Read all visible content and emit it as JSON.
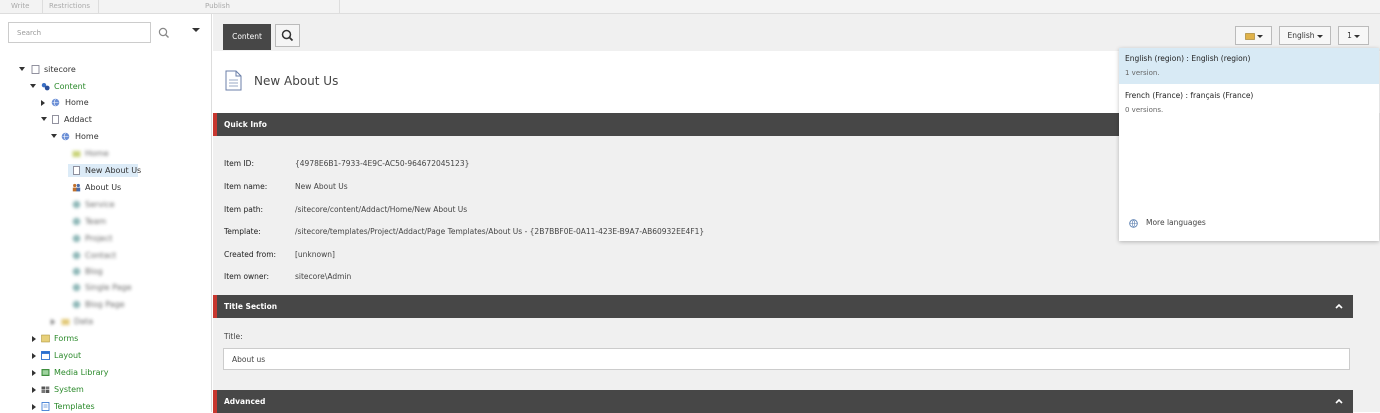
{
  "topbar": {
    "items": [
      "Write",
      "Restrictions",
      "Publish"
    ]
  },
  "sidebar": {
    "search_placeholder": "Search",
    "tree": {
      "sitecore": "sitecore",
      "content": "Content",
      "home1": "Home",
      "addact": "Addact",
      "home2": "Home",
      "blur1": "Home",
      "new_about": "New About Us",
      "about": "About Us",
      "blur2": "Service",
      "blur3": "Team",
      "blur4": "Project",
      "blur5": "Contact",
      "blur6": "Blog",
      "blur7": "Single Page",
      "blur8": "Blog Page",
      "blur9": "Data",
      "forms": "Forms",
      "layout": "Layout",
      "media": "Media Library",
      "system": "System",
      "templates": "Templates"
    }
  },
  "tabs": {
    "content": "Content"
  },
  "item": {
    "title": "New About Us",
    "quick_info_label": "Quick Info",
    "fields": [
      {
        "label": "Item ID:",
        "value": "{4978E6B1-7933-4E9C-AC50-964672045123}"
      },
      {
        "label": "Item name:",
        "value": "New About Us"
      },
      {
        "label": "Item path:",
        "value": "/sitecore/content/Addact/Home/New About Us"
      },
      {
        "label": "Template:",
        "value": "/sitecore/templates/Project/Addact/Page Templates/About Us - {2B7BBF0E-0A11-423E-B9A7-AB60932EE4F1}"
      },
      {
        "label": "Created from:",
        "value": "[unknown]"
      },
      {
        "label": "Item owner:",
        "value": "sitecore\\Admin"
      }
    ],
    "title_section_label": "Title Section",
    "title_field_label": "Title:",
    "title_field_value": "About us",
    "advanced_label": "Advanced"
  },
  "toolbar": {
    "language": "English",
    "version": "1"
  },
  "language_popup": {
    "items": [
      {
        "name": "English (region) : English (region)",
        "versions": "1 version."
      },
      {
        "name": "French (France) : français (France)",
        "versions": "0 versions."
      }
    ],
    "more": "More languages"
  },
  "colors": {
    "accent": "#c7372f",
    "dark_bar": "#474747",
    "selected": "#dcebf7"
  }
}
